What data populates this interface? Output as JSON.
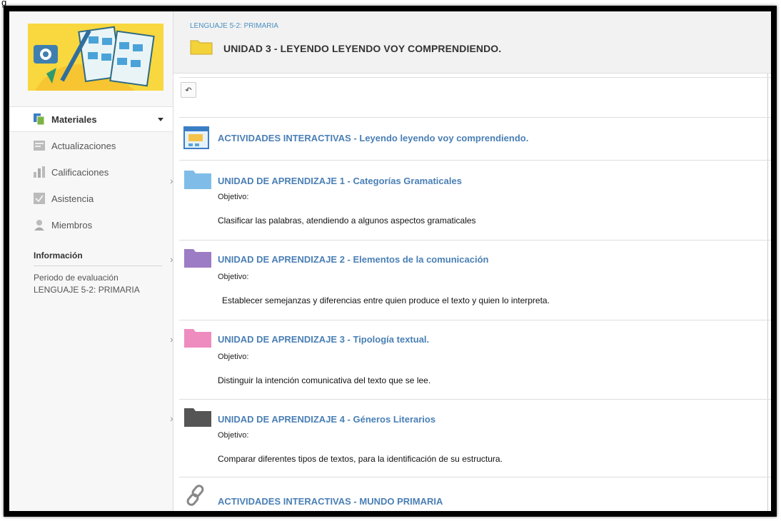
{
  "sidebar": {
    "items": [
      {
        "label": "Materiales",
        "icon": "materials-icon",
        "active": true
      },
      {
        "label": "Actualizaciones",
        "icon": "updates-icon"
      },
      {
        "label": "Calificaciones",
        "icon": "grades-icon"
      },
      {
        "label": "Asistencia",
        "icon": "attendance-icon"
      },
      {
        "label": "Miembros",
        "icon": "members-icon"
      }
    ],
    "info_title": "Información",
    "period_label": "Periodo de evaluación",
    "period_value": "LENGUAJE 5-2: PRIMARIA"
  },
  "header": {
    "breadcrumb": "LENGUAJE 5-2: PRIMARIA",
    "title": "UNIDAD 3 - LEYENDO LEYENDO VOY COMPRENDIENDO."
  },
  "back_icon": "↶",
  "items": [
    {
      "title": "ACTIVIDADES INTERACTIVAS - Leyendo leyendo voy comprendiendo.",
      "icon": "interactive-page-icon"
    },
    {
      "title": "UNIDAD DE APRENDIZAJE 1 - Categorías Gramaticales",
      "objective_label": "Objetivo:",
      "objective": "Clasificar las palabras, atendiendo a algunos aspectos gramaticales",
      "folder_color": "#7fbde8"
    },
    {
      "title": "UNIDAD DE APRENDIZAJE 2 - Elementos de la comunicación",
      "objective_label": "Objetivo:",
      "objective": "Establecer semejanzas y diferencias entre quien produce el texto y quien lo interpreta.",
      "folder_color": "#9c7cc4"
    },
    {
      "title": "UNIDAD DE APRENDIZAJE 3 - Tipología textual.",
      "objective_label": "Objetivo:",
      "objective": "Distinguir la intención comunicativa del texto que se lee.",
      "folder_color": "#ee8cbf"
    },
    {
      "title": "UNIDAD DE APRENDIZAJE 4 - Géneros Literarios",
      "objective_label": "Objetivo:",
      "objective": "Comparar diferentes tipos de textos, para la identificación de su estructura.",
      "folder_color": "#555555"
    },
    {
      "title": "ACTIVIDADES INTERACTIVAS - MUNDO PRIMARIA",
      "icon": "link-icon"
    }
  ],
  "colors": {
    "accent": "#4a7fb5",
    "header_folder": "#f3d23a",
    "logo_bg": "#f9d73f"
  },
  "page_fragment": "g"
}
